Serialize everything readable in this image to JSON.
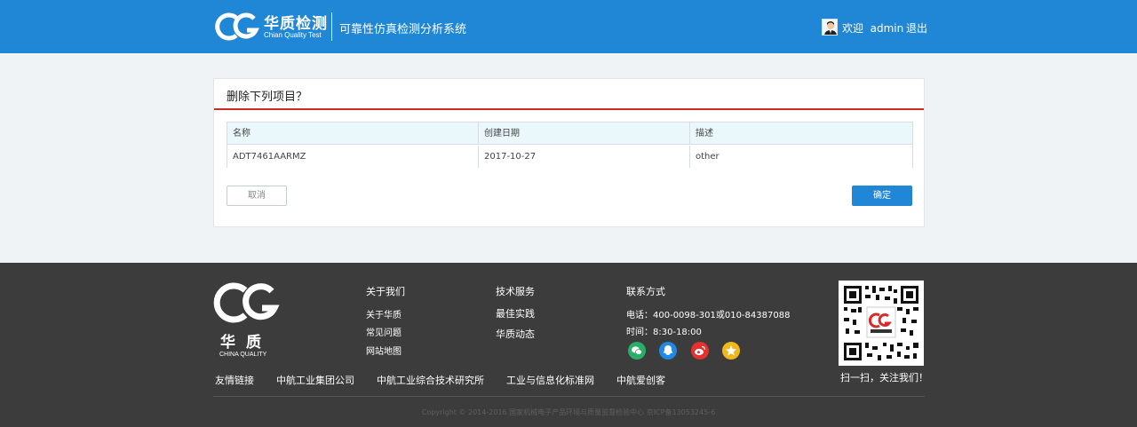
{
  "header": {
    "brand_cn": "华质检测",
    "brand_en": "Chian Quality Test",
    "system_title": "可靠性仿真检测分析系统",
    "welcome": "欢迎  admin",
    "logout": "退出"
  },
  "panel": {
    "title": "删除下列项目？",
    "columns": [
      "名称",
      "创建日期",
      "描述"
    ],
    "rows": [
      [
        "ADT7461AARMZ",
        "2017-10-27",
        "other"
      ]
    ],
    "cancel_label": "取消",
    "confirm_label": "确定"
  },
  "footer": {
    "brand_cn": "华质",
    "brand_en": "CHINA QUALITY",
    "about": {
      "title": "关于我们",
      "links": [
        "关于华质",
        "常见问题",
        "网站地图"
      ]
    },
    "services": {
      "title": "技术服务",
      "links": [
        "最佳实践",
        "华质动态"
      ]
    },
    "contact": {
      "title": "联系方式",
      "phone": "电话：400-0098-301或010-84387088",
      "hours": "时间：8:30-18:00"
    },
    "social_icons": [
      "wechat-icon",
      "qq-icon",
      "weibo-icon",
      "star-icon"
    ],
    "social_colors": [
      "#2aae67",
      "#1e8ae3",
      "#e5322d",
      "#f1b81e"
    ],
    "qr_caption": "扫一扫，关注我们！",
    "friend_links_label": "友情链接",
    "friend_links": [
      "中航工业集团公司",
      "中航工业综合技术研究所",
      "工业与信息化标准网",
      "中航爱创客"
    ],
    "copyright": "Copyright © 2014-2016 国家机械电子产品环境与质量监督检验中心 京ICP备13053245-6"
  }
}
